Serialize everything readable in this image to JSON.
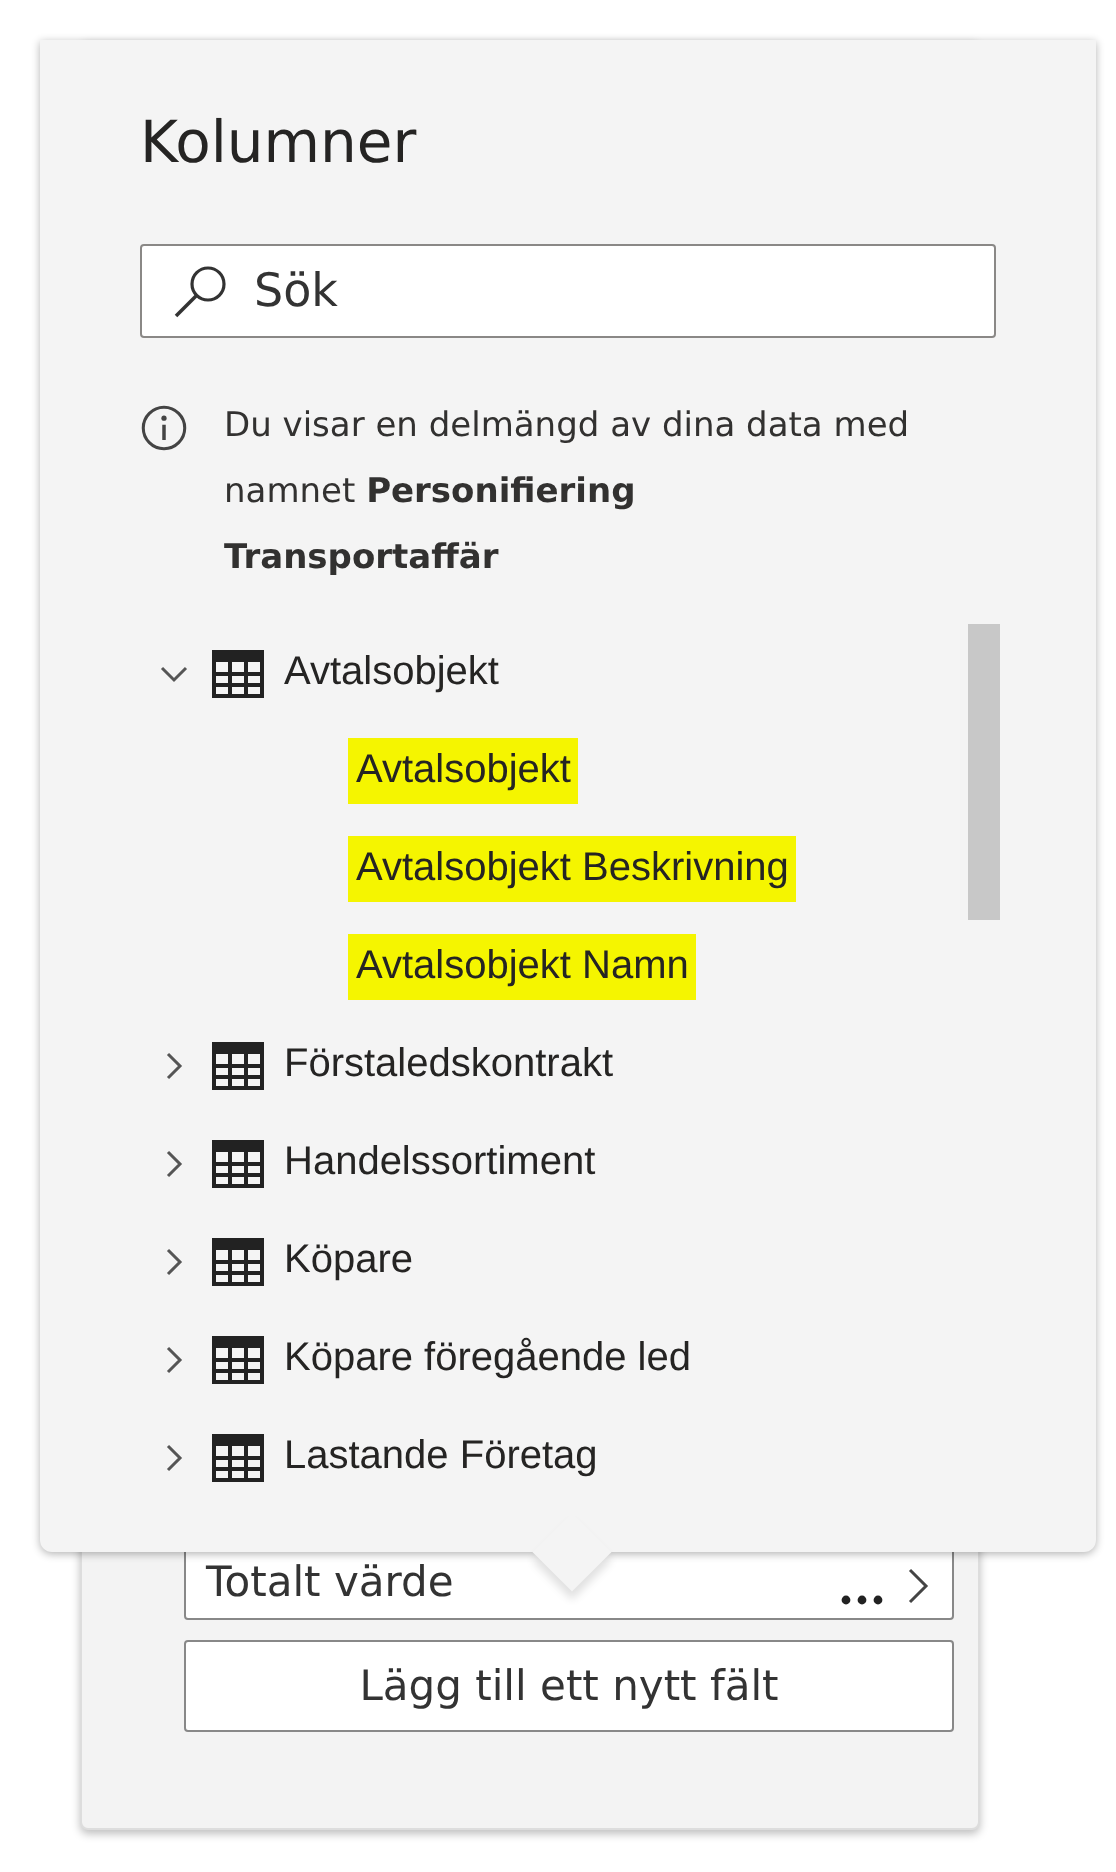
{
  "popup": {
    "title": "Kolumner",
    "search": {
      "placeholder": "Sök"
    },
    "info": "Du visar en delmängd av dina data med namnet **Personifiering Transportaffär**",
    "tables": [
      {
        "name": "Avtalsobjekt",
        "expanded": true,
        "children": [
          {
            "name": "Avtalsobjekt",
            "highlighted": true
          },
          {
            "name": "Avtalsobjekt Beskrivning",
            "highlighted": true
          },
          {
            "name": "Avtalsobjekt Namn",
            "highlighted": true
          }
        ]
      },
      {
        "name": "Förstaledskontrakt",
        "expanded": false
      },
      {
        "name": "Handelssortiment",
        "expanded": false
      },
      {
        "name": "Köpare",
        "expanded": false
      },
      {
        "name": "Köpare föregående led",
        "expanded": false
      },
      {
        "name": "Lastande Företag",
        "expanded": false
      }
    ]
  },
  "panel": {
    "field": {
      "label": "Totalt värde"
    },
    "add_button": "Lägg till ett nytt fält"
  }
}
